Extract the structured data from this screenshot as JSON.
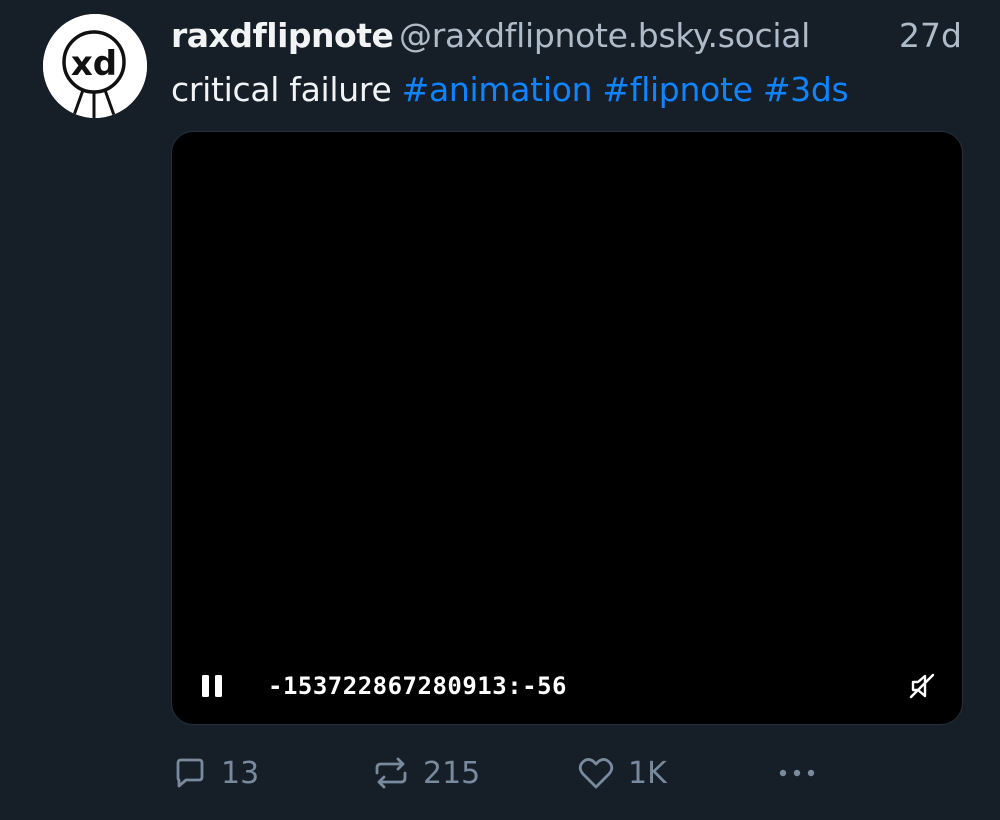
{
  "post": {
    "author": {
      "display_name": "raxdflipnote",
      "handle": "@raxdflipnote.bsky.social",
      "avatar_text": "xd"
    },
    "timestamp": "27d",
    "text": "critical failure",
    "hashtags": [
      "#animation",
      "#flipnote",
      "#3ds"
    ],
    "video": {
      "time_display": "-153722867280913:-56",
      "playing": true,
      "muted": true
    },
    "actions": {
      "reply_count": "13",
      "repost_count": "215",
      "like_count": "1K"
    }
  },
  "colors": {
    "background": "#161e27",
    "text_primary": "#f1f3f5",
    "text_secondary": "#aebbc9",
    "hashtag": "#1083fe",
    "action_icon": "#788a9e"
  },
  "icons": [
    "pause-icon",
    "mute-icon",
    "reply-icon",
    "repost-icon",
    "like-icon",
    "more-icon"
  ]
}
